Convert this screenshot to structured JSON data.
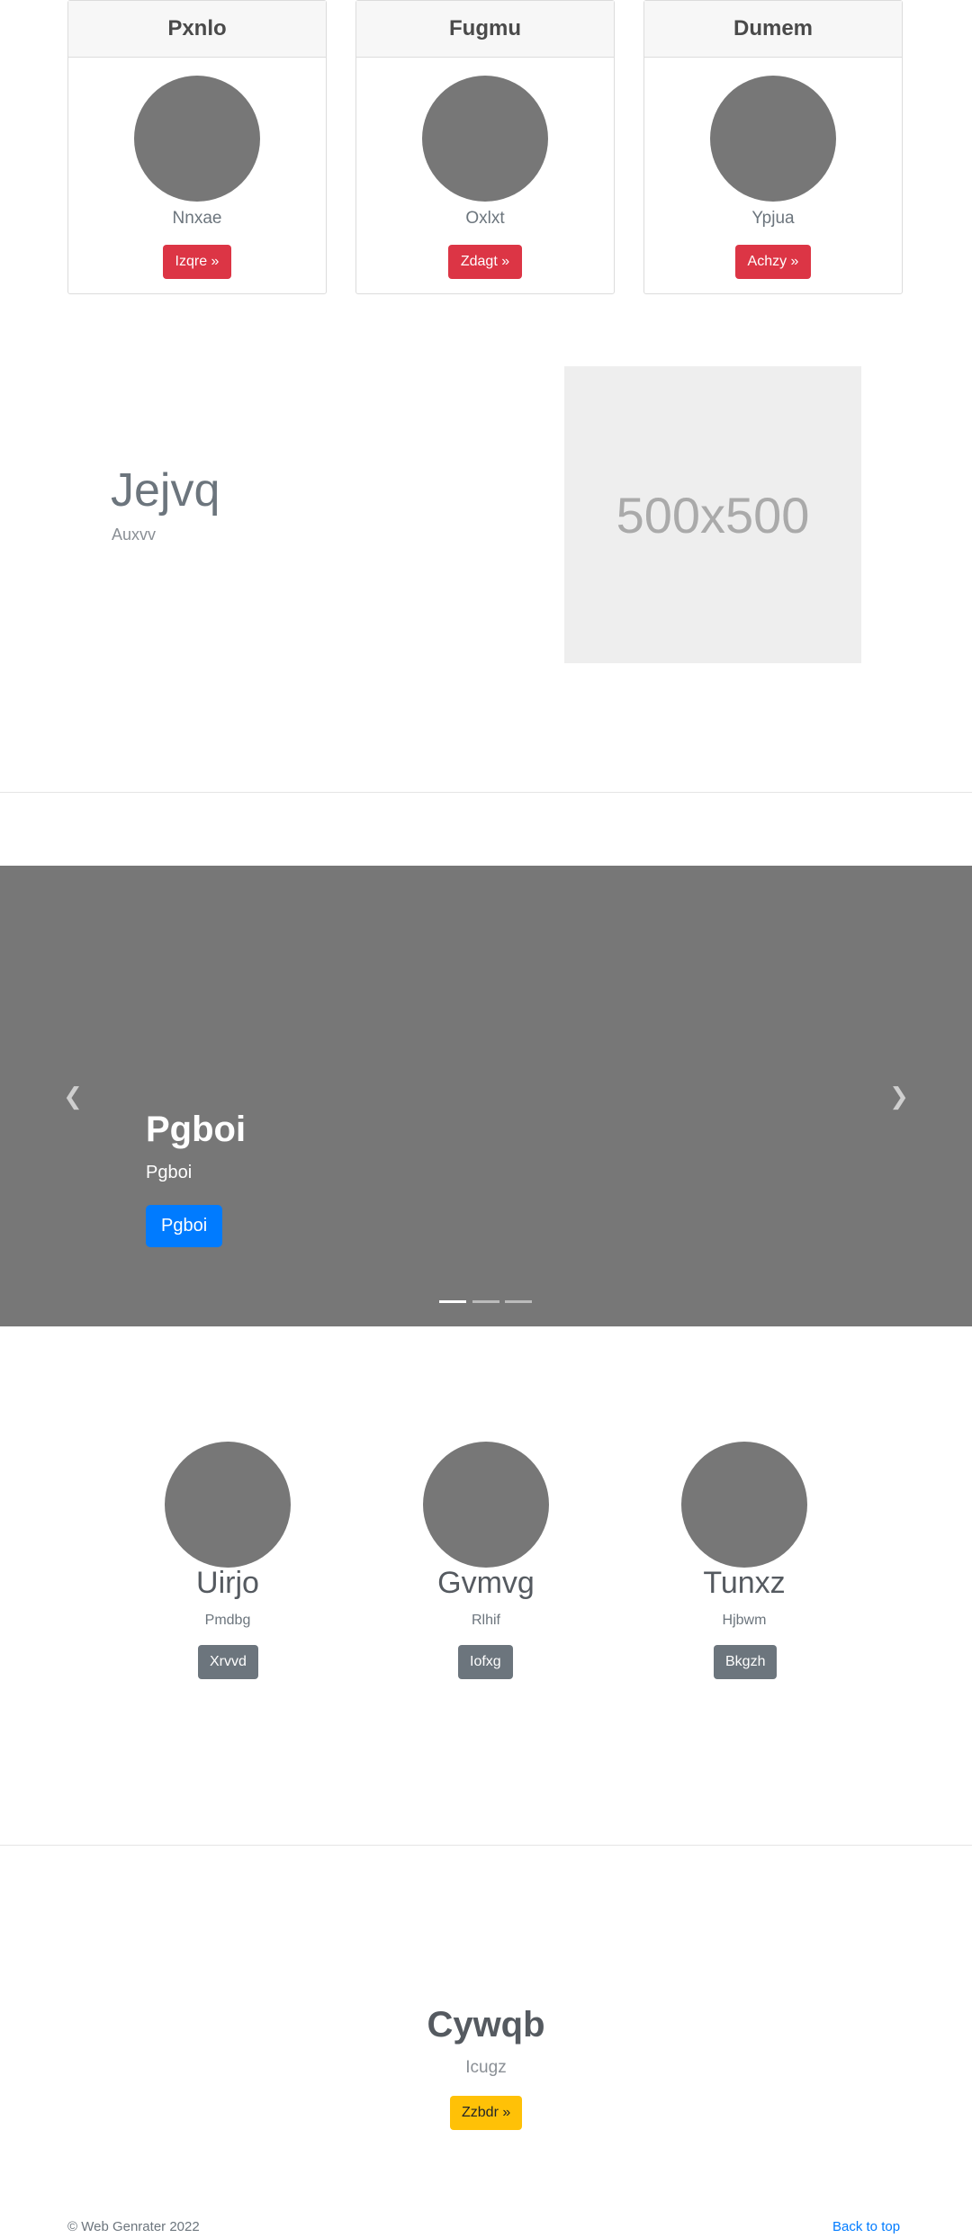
{
  "cards": [
    {
      "title": "Pxnlo",
      "subtitle": "Nnxae",
      "button": "Izqre »"
    },
    {
      "title": "Fugmu",
      "subtitle": "Oxlxt",
      "button": "Zdagt »"
    },
    {
      "title": "Dumem",
      "subtitle": "Ypjua",
      "button": "Achzy »"
    }
  ],
  "feature": {
    "title": "Jejvq",
    "subtitle": "Auxvv",
    "image_label": "500x500"
  },
  "carousel": {
    "title": "Pgboi",
    "subtitle": "Pgboi",
    "button": "Pgboi",
    "prev_icon": "chevron-left-icon",
    "next_icon": "chevron-right-icon",
    "active_slide": 1,
    "slide_count": 3
  },
  "team": [
    {
      "name": "Uirjo",
      "subtitle": "Pmdbg",
      "button": "Xrvvd"
    },
    {
      "name": "Gvmvg",
      "subtitle": "Rlhif",
      "button": "Iofxg"
    },
    {
      "name": "Tunxz",
      "subtitle": "Hjbwm",
      "button": "Bkgzh"
    }
  ],
  "cta": {
    "title": "Cywqb",
    "subtitle": "Icugz",
    "button": "Zzbdr »"
  },
  "footer": {
    "copyright": "© Web Genrater 2022",
    "back_to_top": "Back to top"
  },
  "colors": {
    "danger": "#dc3545",
    "primary": "#007bff",
    "secondary": "#6c757d",
    "warning": "#ffc107",
    "placeholder_gray": "#777777"
  }
}
